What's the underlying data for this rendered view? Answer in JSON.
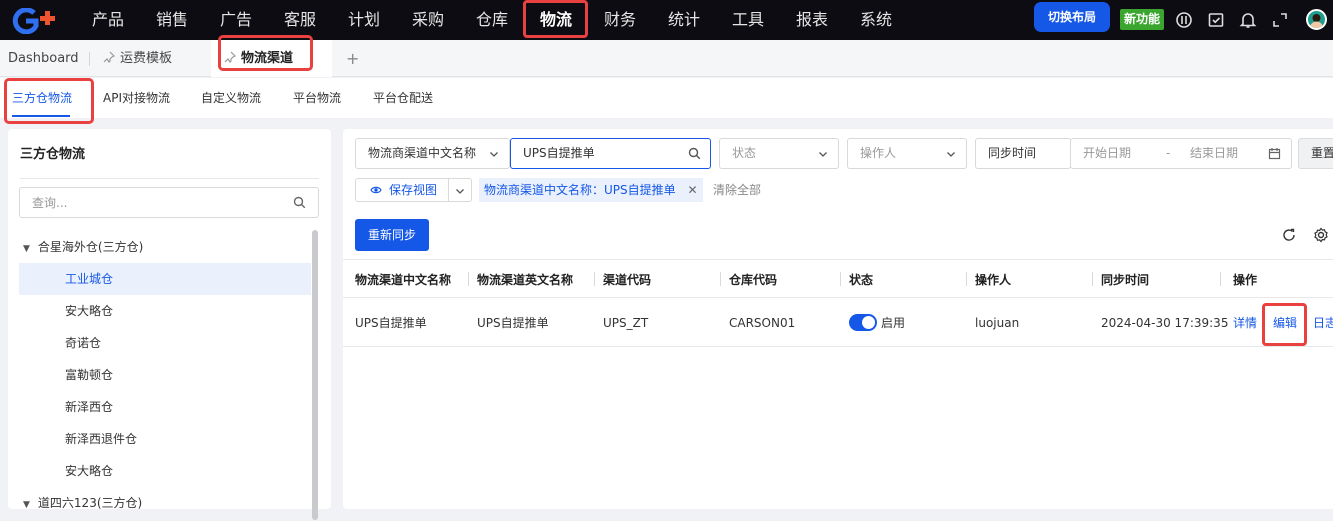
{
  "topbar": {
    "nav": [
      "产品",
      "销售",
      "广告",
      "客服",
      "计划",
      "采购",
      "仓库",
      "物流",
      "财务",
      "统计",
      "工具",
      "报表",
      "系统"
    ],
    "active_nav": "物流",
    "switch_layout": "切换布局",
    "new_feature": "新功能"
  },
  "tabs": {
    "dashboard": "Dashboard",
    "freight_template": "运费模板",
    "logistics_channel": "物流渠道",
    "add": "+"
  },
  "subnav": [
    "三方仓物流",
    "API对接物流",
    "自定义物流",
    "平台物流",
    "平台仓配送"
  ],
  "sidebar": {
    "title": "三方仓物流",
    "search_placeholder": "查询...",
    "group1": "合星海外仓(三方仓)",
    "items": [
      "工业城仓",
      "安大略仓",
      "奇诺仓",
      "富勒顿仓",
      "新泽西仓",
      "新泽西退件仓",
      "安大略仓"
    ],
    "group2": "道四六123(三方仓)"
  },
  "filters": {
    "field_select": "物流商渠道中文名称",
    "search_value": "UPS自提推单",
    "status_placeholder": "状态",
    "operator_placeholder": "操作人",
    "time_type": "同步时间",
    "start_date": "开始日期",
    "date_sep": "-",
    "end_date": "结束日期",
    "reset": "重置",
    "save_view": "保存视图",
    "chip": "物流商渠道中文名称：UPS自提推单",
    "clear_all": "清除全部"
  },
  "resync_button": "重新同步",
  "table": {
    "headers": [
      "物流渠道中文名称",
      "物流渠道英文名称",
      "渠道代码",
      "仓库代码",
      "状态",
      "操作人",
      "同步时间",
      "操作"
    ],
    "rows": [
      {
        "cn_name": "UPS自提推单",
        "en_name": "UPS自提推单",
        "channel_code": "UPS_ZT",
        "warehouse_code": "CARSON01",
        "status": "启用",
        "operator": "luojuan",
        "sync_time": "2024-04-30 17:39:35",
        "actions": [
          "详情",
          "编辑",
          "日志"
        ]
      }
    ]
  },
  "colors": {
    "primary": "#1557e6",
    "highlight": "#e8413f",
    "topbar": "#0c0c12"
  }
}
